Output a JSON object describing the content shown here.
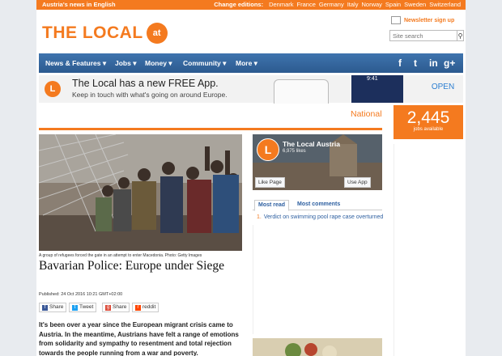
{
  "topbar": {
    "tagline": "Austria's news in English",
    "editions_label": "Change editions:",
    "editions": [
      "Denmark",
      "France",
      "Germany",
      "Italy",
      "Norway",
      "Spain",
      "Sweden",
      "Switzerland"
    ]
  },
  "logo": {
    "text": "THE LOCAL",
    "badge": "at"
  },
  "header": {
    "newsletter": "Newsletter sign up",
    "search_placeholder": "Site search"
  },
  "nav": {
    "items": [
      "News & Features ▾",
      "Jobs ▾",
      "Money ▾",
      "Community ▾",
      "More ▾"
    ],
    "social": [
      "f",
      "t",
      "in",
      "g+"
    ]
  },
  "app_banner": {
    "logo_letter": "L",
    "title": "The Local has a new FREE App.",
    "subtitle": "Keep in touch with what's going on around Europe.",
    "lock_time": "9:41",
    "open_label": "OPEN"
  },
  "section": {
    "label": "National"
  },
  "jobs_box": {
    "count": "2,445",
    "label": "jobs available"
  },
  "article": {
    "caption": "A group of refugees forced the gate in an attempt to enter Macedonia. Photo: Getty Images",
    "headline": "Bavarian Police: Europe under Siege",
    "published": "Published: 24 Oct 2016 10:21 GMT+02:00",
    "share": [
      "Share",
      "Tweet",
      "Share",
      "reddit"
    ],
    "body": "It's been over a year since the European migrant crisis came to Austria. In the meantime, Austrians have felt a range of emotions from solidarity and sympathy to resentment and total rejection towards the people running from a war and poverty."
  },
  "facebook": {
    "logo_letter": "L",
    "page_name": "The Local Austria",
    "likes": "6,975 likes",
    "like_button": "Like Page",
    "app_button": "Use App"
  },
  "tabs": {
    "items": [
      "Most read",
      "Most comments"
    ]
  },
  "most_read": [
    {
      "rank": "1.",
      "title": "Verdict on swimming pool rape case overturned"
    }
  ],
  "colors": {
    "accent": "#f47a1f",
    "nav": "#2c5a8f",
    "link": "#2d5fa0"
  }
}
